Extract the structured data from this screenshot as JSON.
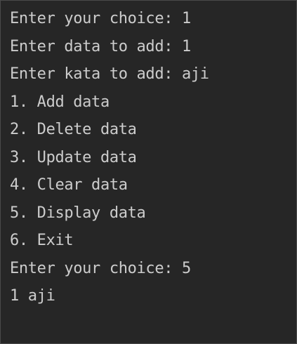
{
  "colors": {
    "background": "#262626",
    "text": "#cccccc",
    "border": "#4a4a4a"
  },
  "terminal": {
    "lines": [
      "Enter your choice: 1",
      "Enter data to add: 1",
      "Enter kata to add: aji",
      "1. Add data",
      "2. Delete data",
      "3. Update data",
      "4. Clear data",
      "5. Display data",
      "6. Exit",
      "Enter your choice: 5",
      "1 aji"
    ]
  }
}
